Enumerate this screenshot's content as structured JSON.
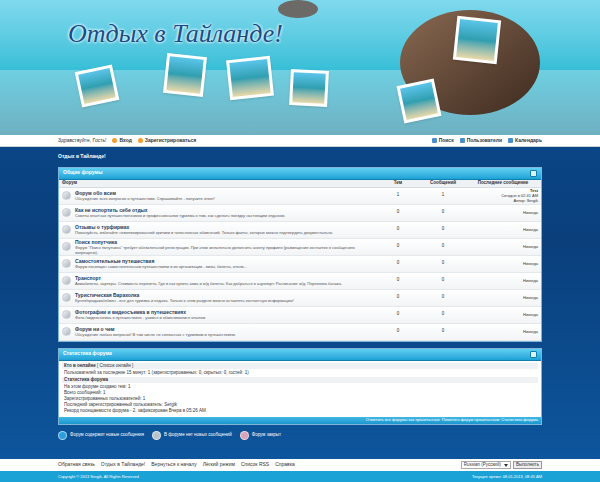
{
  "header": {
    "title": "Отдых в Тайланде!"
  },
  "nav": {
    "greeting": "Здравствуйте, Гость!",
    "left": [
      {
        "label": "Вход"
      },
      {
        "label": "Зарегистрироваться"
      }
    ],
    "right": [
      {
        "label": "Поиск"
      },
      {
        "label": "Пользователи"
      },
      {
        "label": "Календарь"
      }
    ]
  },
  "breadcrumb": "Отдых в Тайланде!",
  "forums": {
    "title": "Общие форумы",
    "columns": [
      "Форум",
      "Тем",
      "Сообщений",
      "Последнее сообщение"
    ],
    "rows": [
      {
        "title": "Форум обо всем",
        "description": "Обсуждение всех вопросов о путешествии. Спрашивайте - получите ответ!",
        "topics": "1",
        "posts": "1",
        "last": [
          "Test",
          "Сегодня в 02:41 AM",
          "Автор: Sergik"
        ]
      },
      {
        "title": "Как не испортить себе отдых",
        "description": "Советы опытных путешественников и профессионалов туризма о том, как сделать поездку настоящим отдыхом.",
        "topics": "0",
        "posts": "0",
        "last": [
          "Никогда"
        ]
      },
      {
        "title": "Отзывы о турфирмах",
        "description": "Пожалуйста, избегайте немотивированной критики и голословных обвинений. Только факты, которые можно подтвердить документально.",
        "topics": "0",
        "posts": "0",
        "last": [
          "Никогда"
        ]
      },
      {
        "title": "Поиск попутчика",
        "description": "Форум \"Поиск попутчика\" требует обязательной регистрации. При этом желательно дополнить анкету профиля (размещение контактов в сообщениях запрещено).",
        "topics": "0",
        "posts": "0",
        "last": [
          "Никогда"
        ]
      },
      {
        "title": "Самостоятельные путешествия",
        "description": "Форум посвящен самостоятельным путешествиям и их организации - визы, билеты, отели...",
        "topics": "0",
        "posts": "0",
        "last": [
          "Никогда"
        ]
      },
      {
        "title": "Транспорт",
        "description": "Авиабилеты, чартеры. Стоимость перелета. Где и как купить авиа и ж/д билеты. Как добраться в аэропорт. Расписание ж/д. Перевозка багажа.",
        "topics": "0",
        "posts": "0",
        "last": [
          "Никогда"
        ]
      },
      {
        "title": "Туристическая Барахолка",
        "description": "Купля/продажа/обмен - все для туризма и отдыха. Только в этом разделе можно оставлять контактную информацию!",
        "topics": "0",
        "posts": "0",
        "last": [
          "Никогда"
        ]
      },
      {
        "title": "Фотографии и видеосъемка в путешествиях",
        "description": "Фото-/видеосъемка в путешествиях - учимся и обмениваемся опытом",
        "topics": "0",
        "posts": "0",
        "last": [
          "Никогда"
        ]
      },
      {
        "title": "Форум ни о чем",
        "description": "Обсуждение любых вопросов! В том числе не связанных с туризмом и путешествием.",
        "topics": "0",
        "posts": "0",
        "last": [
          "Никогда"
        ]
      }
    ]
  },
  "stats": {
    "title": "Статистика форума",
    "online_label": "Кто в онлайне",
    "online_link": "[ Список онлайн ]",
    "online_text": "Пользователей за последние 15 минут: 1 (зарегистрированных: 0, скрытых: 0, гостей: 1)",
    "stats_title": "Статистика форума",
    "lines": [
      "На этом форуме создано тем: 1",
      "Всего сообщений: 1",
      "Зарегистрированных пользователей: 1",
      "Последний зарегистрированный пользователь: Sergik",
      "Рекорд посещаемости форума - 2, зафиксирован Вчера в 05:26 AM"
    ],
    "footer_links": [
      "Отметить все форумы как прочитанные",
      "Пометить форум прочитанным",
      "Статистика форума"
    ]
  },
  "legend": [
    {
      "label": "Форум содержит новые сообщения",
      "color": "#2a9fe0"
    },
    {
      "label": "В форуме нет новых сообщений",
      "color": "#b9c3cc"
    },
    {
      "label": "Форум закрыт",
      "color": "#d9a3b8"
    }
  ],
  "footer": {
    "links": [
      "Обратная связь",
      "Отдых в Тайланде!",
      "Вернуться к началу",
      "Лёгкий режим",
      "Список RSS",
      "Справка"
    ],
    "language": "Russian (Русский)",
    "button": "Выполнить",
    "copyright": "Copyright © 2013 Sergik. All Rights Reserved",
    "time": "Текущее время: 08.01.2013, 08:45 AM"
  }
}
